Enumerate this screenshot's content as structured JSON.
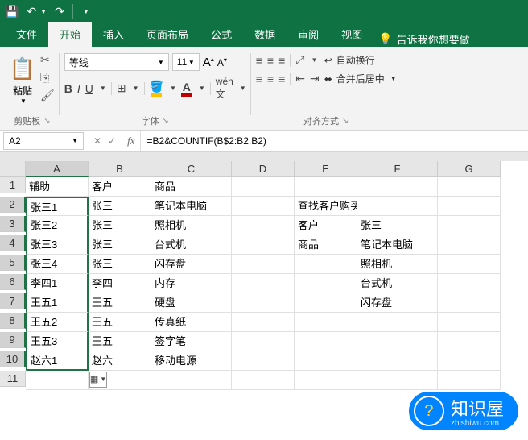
{
  "tabs": {
    "file": "文件",
    "home": "开始",
    "insert": "插入",
    "pagelayout": "页面布局",
    "formulas": "公式",
    "data": "数据",
    "review": "审阅",
    "view": "视图",
    "tellme": "告诉我你想要做"
  },
  "groups": {
    "clipboard": "剪贴板",
    "font": "字体",
    "alignment": "对齐方式"
  },
  "font": {
    "name": "等线",
    "size": "11",
    "bold": "B",
    "italic": "I",
    "underline": "U",
    "grow": "A",
    "shrink": "A"
  },
  "labels": {
    "paste": "粘贴",
    "wrap": "自动换行",
    "merge": "合并后居中"
  },
  "fx": {
    "name_box": "A2",
    "formula": "=B2&COUNTIF(B$2:B2,B2)",
    "fx": "fx"
  },
  "columns": [
    "A",
    "B",
    "C",
    "D",
    "E",
    "F",
    "G"
  ],
  "rows": {
    "1": {
      "A": "辅助",
      "B": "客户",
      "C": "商品",
      "E": "",
      "F": ""
    },
    "2": {
      "A": "张三1",
      "B": "张三",
      "C": "笔记本电脑",
      "E": "查找客户购买商品",
      "F": ""
    },
    "3": {
      "A": "张三2",
      "B": "张三",
      "C": "照相机",
      "E": "客户",
      "F": "张三"
    },
    "4": {
      "A": "张三3",
      "B": "张三",
      "C": "台式机",
      "E": "商品",
      "F": "笔记本电脑"
    },
    "5": {
      "A": "张三4",
      "B": "张三",
      "C": "闪存盘",
      "E": "",
      "F": "照相机"
    },
    "6": {
      "A": "李四1",
      "B": "李四",
      "C": "内存",
      "E": "",
      "F": "台式机"
    },
    "7": {
      "A": "王五1",
      "B": "王五",
      "C": "硬盘",
      "E": "",
      "F": "闪存盘"
    },
    "8": {
      "A": "王五2",
      "B": "王五",
      "C": "传真纸",
      "E": "",
      "F": ""
    },
    "9": {
      "A": "王五3",
      "B": "王五",
      "C": "签字笔",
      "E": "",
      "F": ""
    },
    "10": {
      "A": "赵六1",
      "B": "赵六",
      "C": "移动电源",
      "E": "",
      "F": ""
    }
  },
  "watermark": {
    "text": "知识屋",
    "url": "zhishiwu.com",
    "icon": "?"
  }
}
